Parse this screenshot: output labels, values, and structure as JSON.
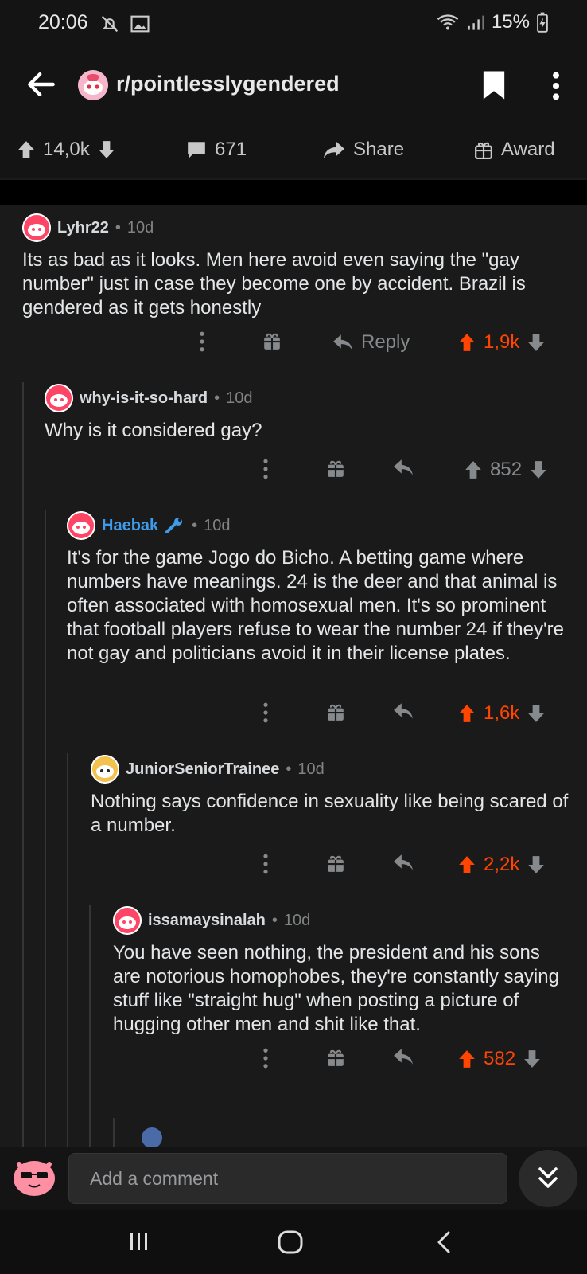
{
  "status": {
    "time": "20:06",
    "battery": "15%",
    "icons": [
      "mute-icon",
      "image-icon",
      "wifi-icon",
      "signal-icon",
      "battery-charging-icon"
    ]
  },
  "topbar": {
    "subreddit": "r/pointlesslygendered",
    "icons": [
      "back-arrow-icon",
      "subreddit-avatar",
      "bookmark-icon",
      "more-vert-icon"
    ]
  },
  "post_actions": {
    "score": "14,0k",
    "comments": "671",
    "share_label": "Share",
    "award_label": "Award"
  },
  "comments": [
    {
      "author": "Lyhr22",
      "age": "10d",
      "body": "Its as bad as it looks. Men here avoid even saying the \"gay number\" just in case they become one by accident. Brazil is gendered as it gets honestly",
      "reply_label": "Reply",
      "score": "1,9k",
      "upvoted": true
    },
    {
      "author": "why-is-it-so-hard",
      "age": "10d",
      "body": "Why is it considered gay?",
      "score": "852",
      "upvoted": false
    },
    {
      "author": "Haebak",
      "age": "10d",
      "body": "It's for the game Jogo do Bicho. A betting game where numbers have meanings. 24 is the deer and that animal is often associated with homosexual men. It's so prominent that football players refuse to wear the number 24 if they're not gay and politicians avoid it in their license plates.",
      "score": "1,6k",
      "upvoted": true,
      "moderator": true
    },
    {
      "author": "JuniorSeniorTrainee",
      "age": "10d",
      "body": "Nothing says confidence in sexuality like being scared of a number.",
      "score": "2,2k",
      "upvoted": true
    },
    {
      "author": "issamaysinalah",
      "age": "10d",
      "body": "You have seen nothing, the president and his sons are notorious homophobes, they're constantly saying stuff like \"straight hug\" when posting a picture of hugging other men and shit like that.",
      "score": "582",
      "upvoted": true
    }
  ],
  "composer": {
    "placeholder": "Add a comment"
  },
  "colors": {
    "background": "#1a1a1b",
    "upvote_accent": "#ff4500",
    "mod_blue": "#3d9be9",
    "muted": "#818384"
  }
}
